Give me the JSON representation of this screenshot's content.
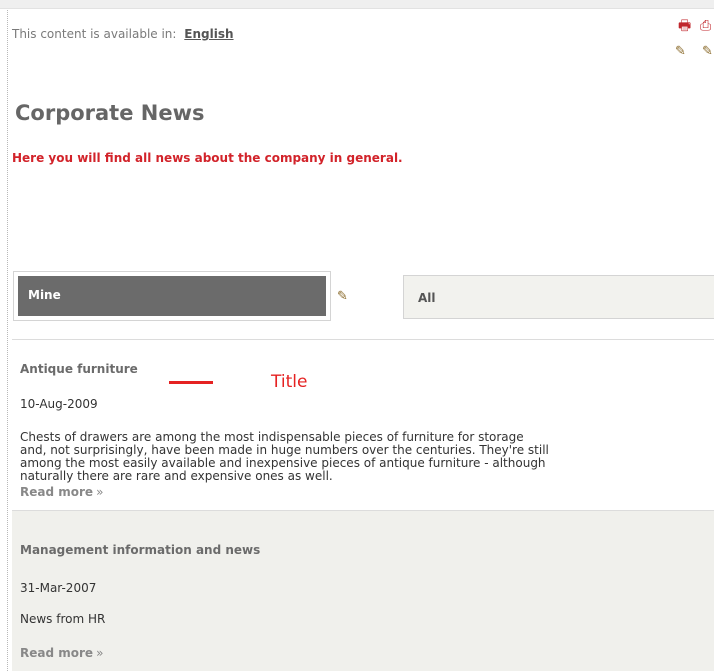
{
  "availability": {
    "prefix": "This content is available in:",
    "language": "English"
  },
  "toolbar": {
    "icon1": "🖶",
    "icon2": "⎙",
    "icon3": "✎",
    "icon4": "✎"
  },
  "page": {
    "title": "Corporate News",
    "intro": "Here you will find all news about the company in general."
  },
  "tabs": [
    {
      "label": "Mine"
    },
    {
      "label": "All"
    }
  ],
  "news": [
    {
      "title": "Antique furniture",
      "date": "10-Aug-2009",
      "body": "Chests of drawers are among the most indispensable pieces of furniture for storage\nand, not surprisingly, have been made in huge numbers over the centuries. They're still\namong the most easily available and inexpensive pieces of antique furniture - although\nnaturally there are rare and expensive ones as well.",
      "more": "Read more",
      "chev": "»"
    },
    {
      "title": "Management information and news",
      "date": "31-Mar-2007",
      "body": "News from HR",
      "more": "Read more",
      "chev": "»"
    }
  ],
  "annotation": {
    "label": "Title",
    "color": "#e52222"
  }
}
